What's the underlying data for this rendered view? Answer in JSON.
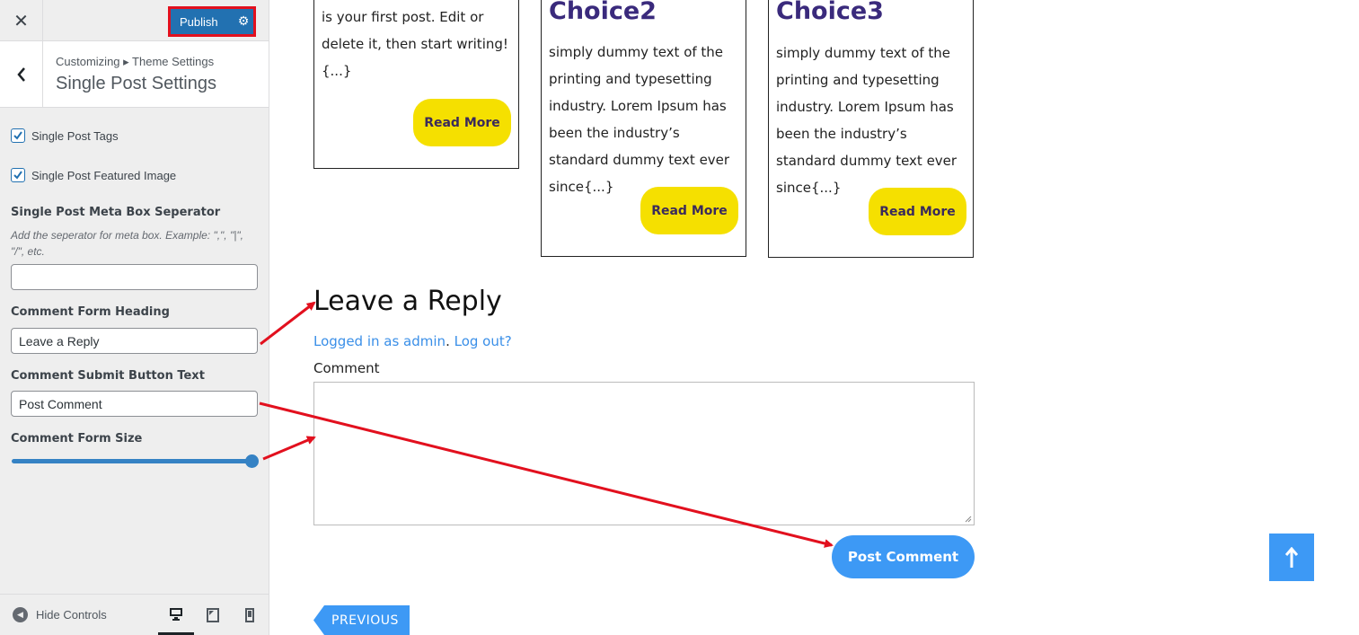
{
  "sidebar": {
    "close_symbol": "✕",
    "publish_label": "Publish",
    "breadcrumb": "Customizing ▸ Theme Settings",
    "section_title": "Single Post Settings",
    "checkboxes": [
      {
        "label": "Single Post Tags",
        "checked": true
      },
      {
        "label": "Single Post Featured Image",
        "checked": true
      }
    ],
    "meta_separator": {
      "title": "Single Post Meta Box Seperator",
      "description": "Add the seperator for meta box. Example: \",\", \"|\", \"/\", etc.",
      "value": ""
    },
    "comment_heading": {
      "title": "Comment Form Heading",
      "value": "Leave a Reply"
    },
    "submit_text": {
      "title": "Comment Submit Button Text",
      "value": "Post Comment"
    },
    "form_size": {
      "title": "Comment Form Size",
      "value_fraction": 1.0
    },
    "footer": {
      "hide_controls": "Hide Controls",
      "devices": [
        "desktop-icon",
        "tablet-icon",
        "mobile-icon"
      ],
      "active_device": "desktop"
    }
  },
  "preview": {
    "cards": [
      {
        "text": "is your first post. Edit or delete it, then start writing! {...}",
        "read_more": "Read More"
      },
      {
        "title": "Choice2",
        "text": "simply dummy text of the printing and typesetting industry. Lorem Ipsum has been the industry’s standard dummy text ever since{...}",
        "read_more": "Read More"
      },
      {
        "title": "Choice3",
        "text": "simply dummy text of the printing and typesetting industry. Lorem Ipsum has been the industry’s standard dummy text ever since{...}",
        "read_more": "Read More"
      }
    ],
    "reply_title": "Leave a Reply",
    "logged_in_text": "Logged in as admin",
    "separator": ".",
    "logout_text": "Log out?",
    "comment_label": "Comment",
    "post_button": "Post Comment",
    "previous_button": "PREVIOUS"
  },
  "colors": {
    "accent": "#3d99f5",
    "read_more": "#f5e000",
    "annotation": "#e2101e",
    "publish": "#2271b1"
  }
}
